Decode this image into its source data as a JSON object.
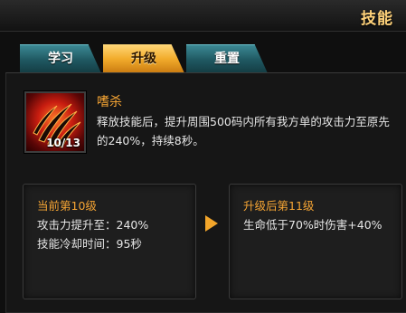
{
  "window": {
    "title": "技能"
  },
  "tabs": [
    {
      "label": "学习",
      "active": false
    },
    {
      "label": "升级",
      "active": true
    },
    {
      "label": "重置",
      "active": false
    }
  ],
  "skill": {
    "icon": "claw-icon",
    "name": "嗜杀",
    "level_current": "10",
    "level_max": "/13",
    "description": "释放技能后，提升周围500码内所有我方单的攻击力至原先的240%，持续8秒。"
  },
  "current_level": {
    "title": "当前第10级",
    "lines": [
      "攻击力提升至：240%",
      "技能冷却时间：95秒"
    ]
  },
  "next_level": {
    "title": "升级后第11级",
    "lines": [
      "生命低于70%时伤害+40%"
    ]
  },
  "colors": {
    "accent": "#f6a534",
    "tab_active": "#f2ac2c",
    "tab_normal": "#1f5861",
    "background": "#161616"
  }
}
